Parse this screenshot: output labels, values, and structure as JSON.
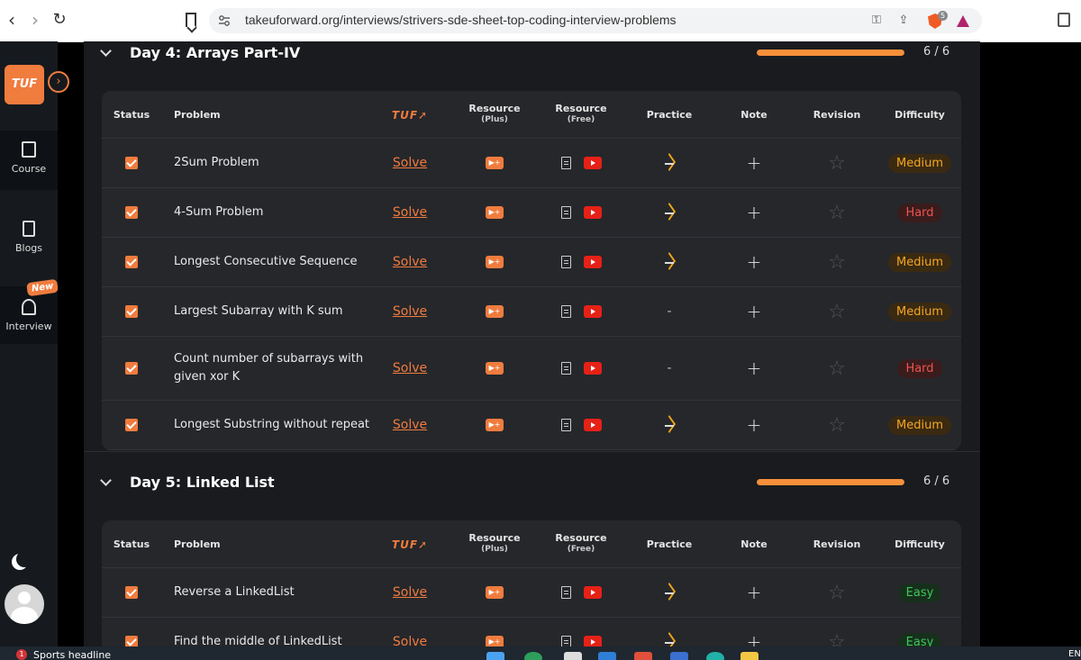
{
  "browser": {
    "url": "takeuforward.org/interviews/strivers-sde-sheet-top-coding-interview-problems",
    "shield_count": "5"
  },
  "sidebar": {
    "logo": "TUF",
    "items": [
      {
        "label": "Course"
      },
      {
        "label": "Blogs"
      },
      {
        "label": "Interview",
        "badge": "New"
      }
    ]
  },
  "headers": {
    "status": "Status",
    "problem": "Problem",
    "tuf": "TUF",
    "resource_plus": "Resource",
    "resource_plus_sub": "(Plus)",
    "resource_free": "Resource",
    "resource_free_sub": "(Free)",
    "practice": "Practice",
    "note": "Note",
    "revision": "Revision",
    "difficulty": "Difficulty"
  },
  "sections": [
    {
      "title": "Day 4: Arrays Part-IV",
      "progress_text": "6 / 6",
      "progress_fraction": 1.0,
      "rows": [
        {
          "name": "2Sum Problem",
          "solve": "Solve",
          "practice": true,
          "difficulty": "Medium"
        },
        {
          "name": "4-Sum Problem",
          "solve": "Solve",
          "practice": true,
          "difficulty": "Hard"
        },
        {
          "name": "Longest Consecutive Sequence",
          "solve": "Solve",
          "practice": true,
          "difficulty": "Medium"
        },
        {
          "name": "Largest Subarray with K sum",
          "solve": "Solve",
          "practice": false,
          "difficulty": "Medium"
        },
        {
          "name": "Count number of subarrays with given xor K",
          "solve": "Solve",
          "practice": false,
          "difficulty": "Hard"
        },
        {
          "name": "Longest Substring without repeat",
          "solve": "Solve",
          "practice": true,
          "difficulty": "Medium"
        }
      ]
    },
    {
      "title": "Day 5: Linked List",
      "progress_text": "6 / 6",
      "progress_fraction": 1.0,
      "rows": [
        {
          "name": "Reverse a LinkedList",
          "solve": "Solve",
          "practice": true,
          "difficulty": "Easy"
        },
        {
          "name": "Find the middle of LinkedList",
          "solve": "Solve",
          "practice": true,
          "difficulty": "Easy"
        }
      ]
    }
  ],
  "symbols": {
    "plus_resource": "▶+",
    "dash": "-",
    "plus": "+",
    "star": "☆"
  },
  "taskbar": {
    "news_count": "1",
    "news_text": "Sports headline",
    "lang": "EN"
  },
  "colors": {
    "accent": "#f07c3e",
    "medium": "#f5a623",
    "hard": "#ef5350",
    "easy": "#3fc55a"
  }
}
